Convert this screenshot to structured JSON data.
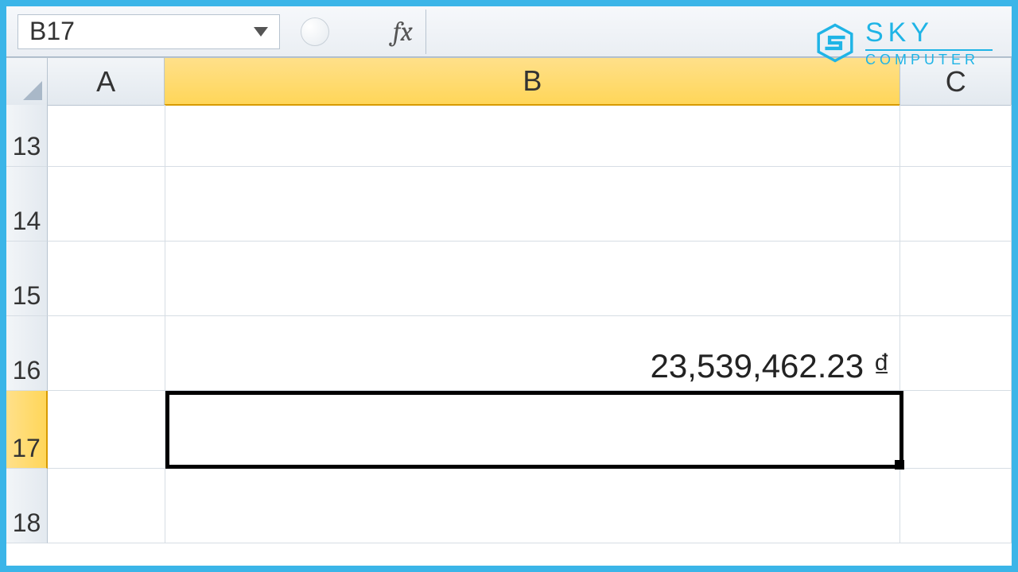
{
  "formula_bar": {
    "name_box_value": "B17",
    "fx_label": "fx",
    "formula_value": ""
  },
  "columns": [
    {
      "label": "A",
      "selected": false
    },
    {
      "label": "B",
      "selected": true
    },
    {
      "label": "C",
      "selected": false
    }
  ],
  "rows": [
    {
      "label": "13",
      "selected": false
    },
    {
      "label": "14",
      "selected": false
    },
    {
      "label": "15",
      "selected": false
    },
    {
      "label": "16",
      "selected": false
    },
    {
      "label": "17",
      "selected": true
    },
    {
      "label": "18",
      "selected": false
    }
  ],
  "cells": {
    "B16": "23,539,462.23 ₫"
  },
  "selection": {
    "active_cell": "B17"
  },
  "watermark": {
    "line1": "SKY",
    "line2": "COMPUTER"
  },
  "colors": {
    "frame": "#3bb5e8",
    "col_selected": "#ffd659",
    "brand": "#1fb4e6"
  }
}
